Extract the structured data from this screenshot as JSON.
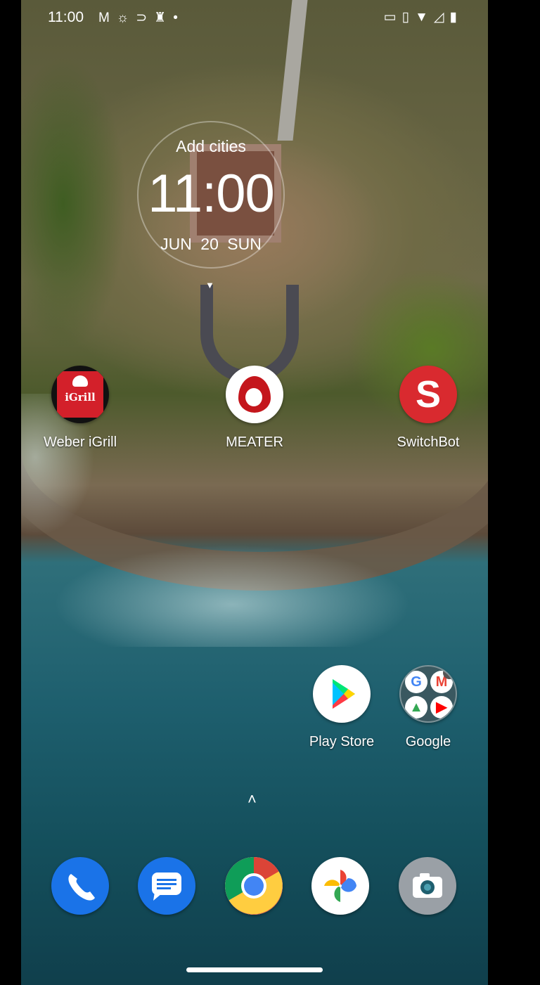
{
  "status_bar": {
    "time": "11:00",
    "left_icons": [
      "gmail-icon",
      "brightness-icon",
      "media-icon",
      "cone-icon",
      "dot-icon"
    ],
    "right_icons": [
      "cast-icon",
      "vibrate-icon",
      "wifi-icon",
      "signal-icon",
      "battery-icon"
    ]
  },
  "clock_widget": {
    "add_cities": "Add cities",
    "time": "11:00",
    "date": "JUN 20 SUN"
  },
  "apps": [
    {
      "label": "Weber iGrill",
      "icon": "igrill-icon",
      "brand_color": "#d3202a"
    },
    {
      "label": "MEATER",
      "icon": "meater-icon",
      "brand_color": "#c4161c"
    },
    {
      "label": "SwitchBot",
      "icon": "switchbot-icon",
      "brand_color": "#d92a2f"
    },
    {
      "label": "Play Store",
      "icon": "play-store-icon"
    },
    {
      "label": "Google",
      "icon": "google-folder-icon"
    }
  ],
  "dock": [
    {
      "name": "phone-icon",
      "color": "#1a73e8"
    },
    {
      "name": "messages-icon",
      "color": "#1a73e8"
    },
    {
      "name": "chrome-icon"
    },
    {
      "name": "photos-icon"
    },
    {
      "name": "camera-icon",
      "color": "#9aa0a6"
    }
  ]
}
